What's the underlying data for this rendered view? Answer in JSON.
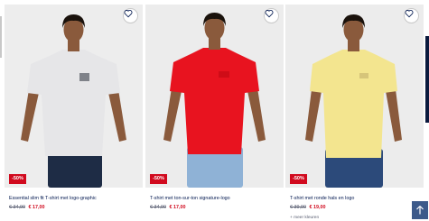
{
  "products": [
    {
      "name": "Essential slim fit T-shirt met logo-graphic",
      "old_price": "€ 34,90",
      "new_price": "€ 17,00",
      "discount": "-50%",
      "shirt_color": "#e6e6e8",
      "pants_color": "#1e2c45",
      "bg_color": "#ededed"
    },
    {
      "name": "T-shirt met ton-sur-ton signature-logo",
      "old_price": "€ 34,90",
      "new_price": "€ 17,00",
      "discount": "-50%",
      "shirt_color": "#e8131f",
      "pants_color": "#8fb2d6",
      "bg_color": "#ececec"
    },
    {
      "name": "T-shirt met ronde hals en logo",
      "old_price": "€ 39,90",
      "new_price": "€ 19,00",
      "discount": "-50%",
      "colors_label": "+ meer kleuren",
      "shirt_color": "#f3e58f",
      "pants_color": "#2c4a7a",
      "bg_color": "#ececec"
    }
  ],
  "colors": {
    "sale_red": "#d10a1e",
    "navy": "#00174f",
    "back_to_top": "#3d5a8a"
  },
  "icons": {
    "favorite": "heart-icon",
    "back_to_top": "arrow-up-icon"
  }
}
